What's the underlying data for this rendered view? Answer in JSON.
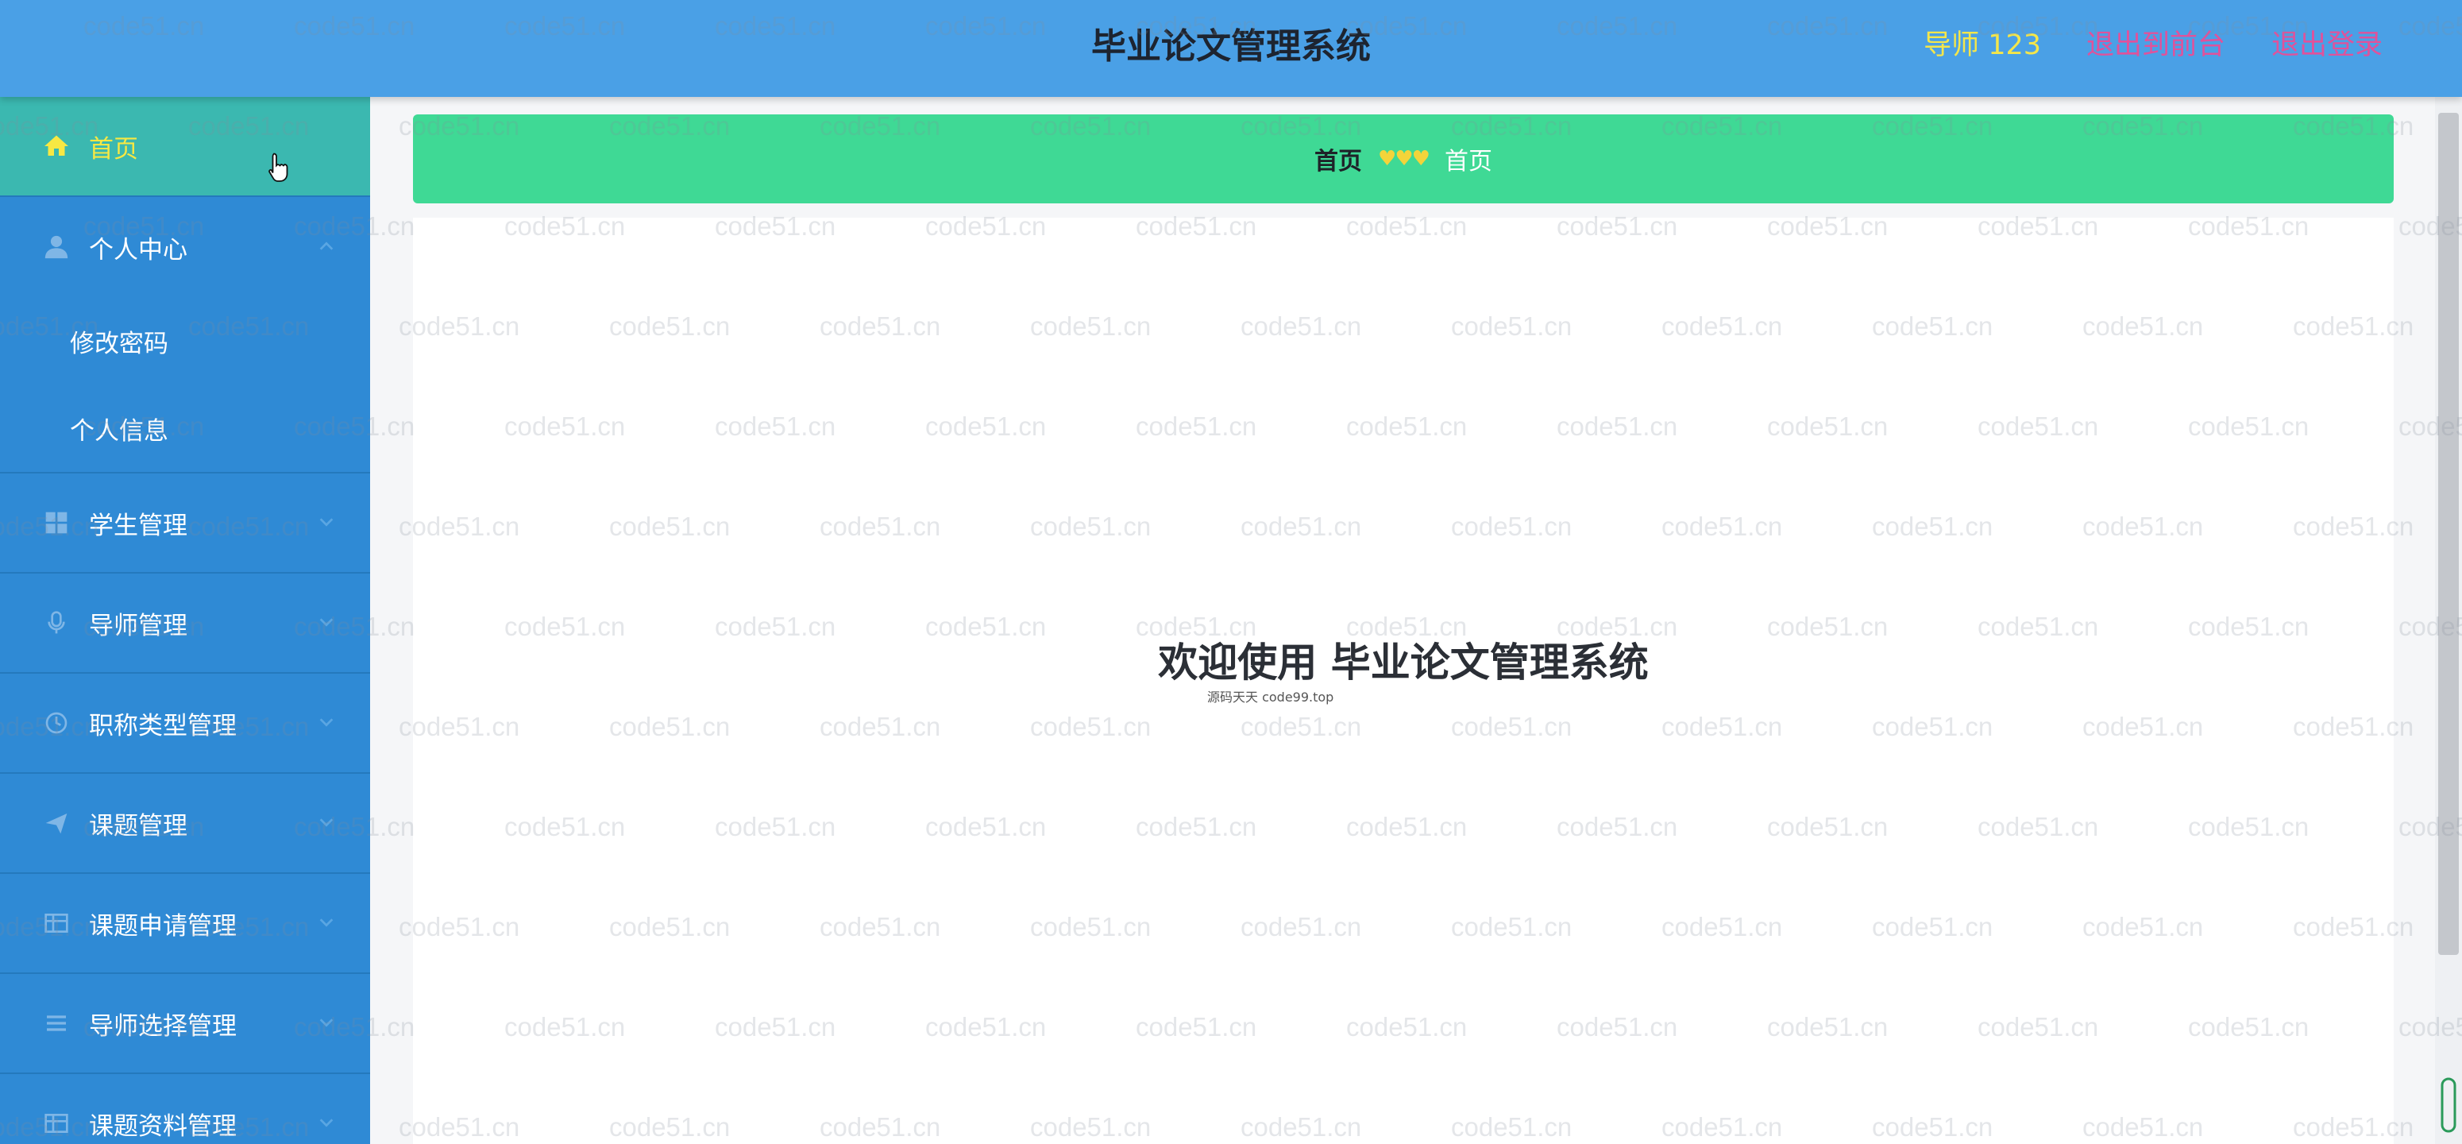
{
  "app": {
    "title": "毕业论文管理系统",
    "user_label": "导师 123",
    "front_link": "退出到前台",
    "logout_link": "退出登录"
  },
  "sidebar": {
    "items": [
      {
        "label": "首页",
        "icon": "home-icon",
        "active": true
      },
      {
        "label": "个人中心",
        "icon": "user-icon",
        "open": true,
        "children": [
          {
            "label": "修改密码"
          },
          {
            "label": "个人信息"
          }
        ]
      },
      {
        "label": "学生管理",
        "icon": "grid-icon"
      },
      {
        "label": "导师管理",
        "icon": "microphone-icon"
      },
      {
        "label": "职称类型管理",
        "icon": "refresh-icon"
      },
      {
        "label": "课题管理",
        "icon": "send-icon"
      },
      {
        "label": "课题申请管理",
        "icon": "table-icon"
      },
      {
        "label": "导师选择管理",
        "icon": "list-icon"
      },
      {
        "label": "课题资料管理",
        "icon": "table-icon"
      }
    ]
  },
  "breadcrumb": {
    "home": "首页",
    "separator": "♥♥♥",
    "current": "首页"
  },
  "main": {
    "welcome": "欢迎使用 毕业论文管理系统",
    "note": "源码天天 code99.top"
  },
  "watermark": {
    "text": "code51.cn"
  },
  "colors": {
    "header": "#4aa0e6",
    "sidebar": "#2f8ad5",
    "active_item": "#3bb8b0",
    "breadcrumb": "#3fd995",
    "accent_yellow": "#f7e843",
    "link_pink": "#e0529b"
  }
}
